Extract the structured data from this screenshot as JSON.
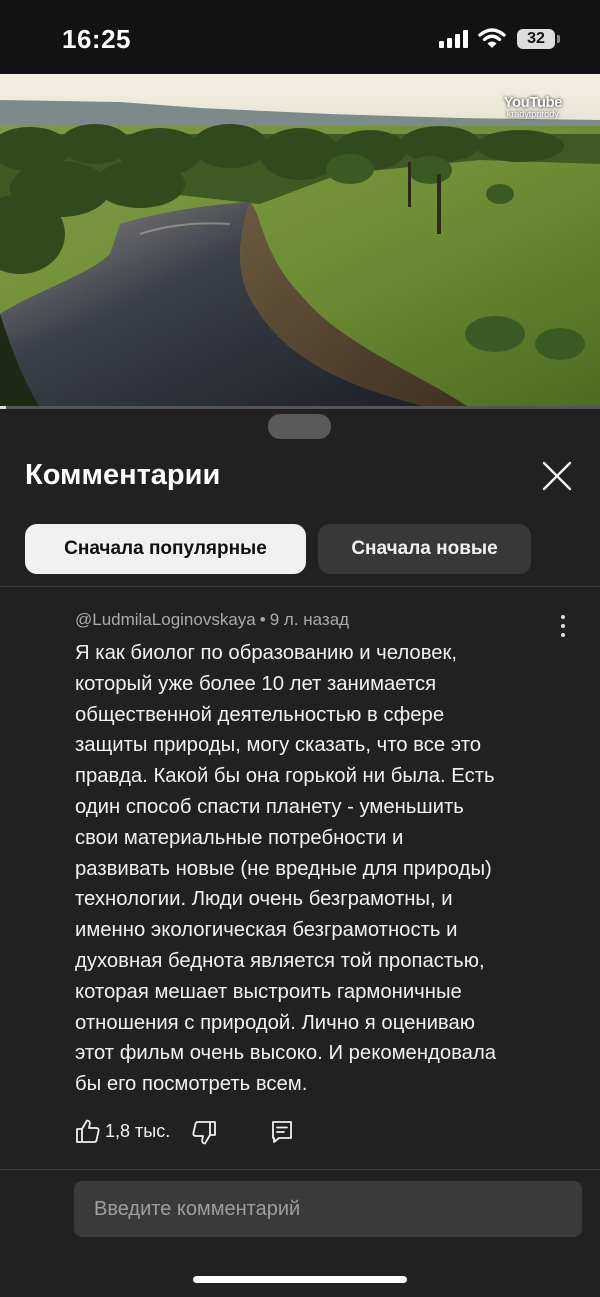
{
  "status_bar": {
    "time": "16:25",
    "battery": "32",
    "icons": [
      "signal-icon",
      "wifi-icon",
      "battery-icon"
    ]
  },
  "video": {
    "watermark_logo": "YouTube",
    "watermark_channel": "kradytprirody",
    "progress_fraction": 0.01
  },
  "comments_sheet": {
    "title": "Комментарии",
    "close_icon": "close-icon",
    "sort_chips": [
      {
        "label": "Сначала популярные",
        "selected": true
      },
      {
        "label": "Сначала новые",
        "selected": false
      }
    ],
    "comment": {
      "author": "@LudmilaLoginovskaya",
      "separator": "•",
      "time": "9 л. назад",
      "text": "Я как биолог по образованию и человек,\nкоторый уже более 10 лет занимается\nобщественной деятельностью в сфере\nзащиты природы, могу сказать, что все это\nправда. Какой бы она горькой ни была. Есть\nодин способ спасти планету - уменьшить\nсвои материальные потребности и\nразвивать новые (не вредные для природы)\nтехнологии. Люди очень безграмотны, и\nименно экологическая безграмотность и\nдуховная беднота является той пропастью,\nкоторая мешает выстроить гармоничные\nотношения с природой. Лично я оцениваю\nэтот фильм очень высоко. И рекомендовала\nбы его посмотреть всем.",
      "likes": "1,8 тыс.",
      "icons": [
        "like-icon",
        "dislike-icon",
        "reply-icon",
        "more-vert-icon"
      ]
    },
    "input_placeholder": "Введите комментарий"
  },
  "colors": {
    "background": "#0f0f0f",
    "sheet": "#212121",
    "chip_active": "#f1f1f1",
    "chip_inactive": "#383838",
    "muted_text": "#aaaaaa"
  }
}
